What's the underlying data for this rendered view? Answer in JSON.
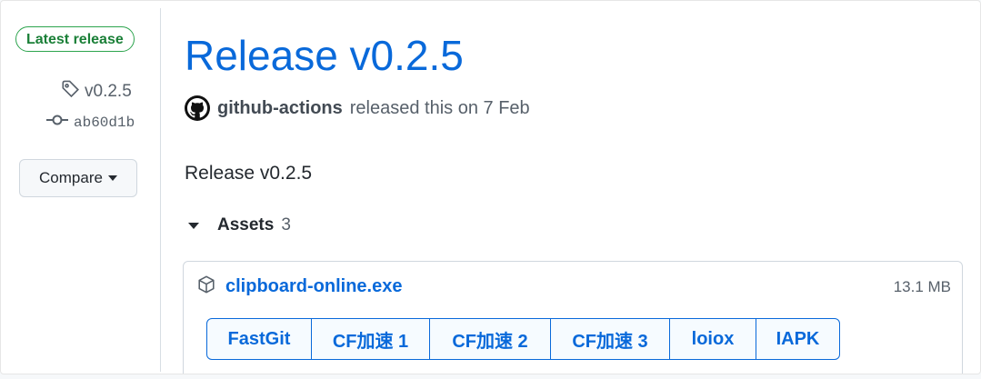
{
  "sidebar": {
    "latest_badge": "Latest release",
    "tag": "v0.2.5",
    "commit": "ab60d1b",
    "compare_label": "Compare"
  },
  "release": {
    "title": "Release v0.2.5",
    "author": "github-actions",
    "released_text": "released this on 7 Feb",
    "body": "Release v0.2.5"
  },
  "assets": {
    "label": "Assets",
    "count": "3",
    "items": [
      {
        "name": "clipboard-online.exe",
        "size": "13.1 MB",
        "mirrors": [
          "FastGit",
          "CF加速 1",
          "CF加速 2",
          "CF加速 3",
          "loiox",
          "IAPK"
        ]
      }
    ]
  },
  "colors": {
    "link": "#0969da",
    "badge_green": "#1a7f37"
  }
}
